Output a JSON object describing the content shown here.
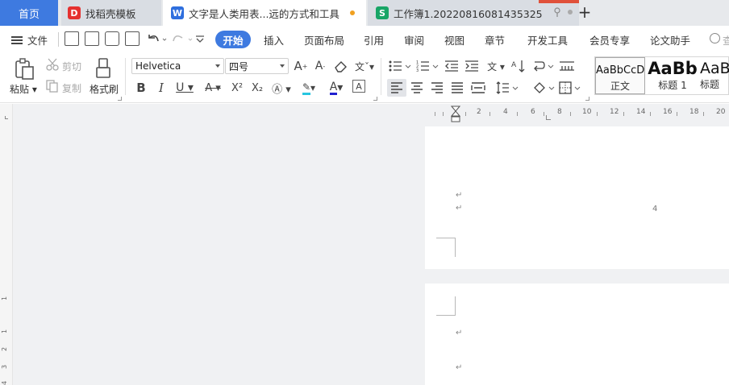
{
  "tabs": {
    "home": "首页",
    "template": "找稻壳模板",
    "doc": "文字是人类用表...远的方式和工具",
    "sheet": "工作簿1.20220816081435325",
    "template_icon": "D",
    "doc_icon": "W",
    "sheet_icon": "S",
    "add_symbol": "+"
  },
  "menu": {
    "file": "文件",
    "start": "开始",
    "items": [
      "插入",
      "页面布局",
      "引用",
      "审阅",
      "视图",
      "章节",
      "开发工具",
      "会员专享",
      "论文助手"
    ],
    "search": "查"
  },
  "ribbon": {
    "paste": "粘贴",
    "cut": "剪切",
    "copy": "复制",
    "format_painter": "格式刷",
    "font_name": "Helvetica",
    "font_size": "四号",
    "styles": [
      {
        "preview": "AaBbCcD",
        "name": "正文"
      },
      {
        "preview": "AaBb",
        "name": "标题 1"
      },
      {
        "preview": "AaB",
        "name": "标题"
      }
    ]
  },
  "ruler": {
    "h_numbers": [
      "2",
      "4",
      "6",
      "8",
      "10",
      "12",
      "14",
      "16",
      "18",
      "20"
    ],
    "v_numbers": [
      "1",
      "1",
      "2",
      "3",
      "4"
    ]
  },
  "document": {
    "page_number": "4",
    "para_mark": "↵"
  },
  "colors": {
    "accent": "#3e7ae0",
    "highlight": "#27c6e0",
    "font_color": "#2020d0"
  }
}
